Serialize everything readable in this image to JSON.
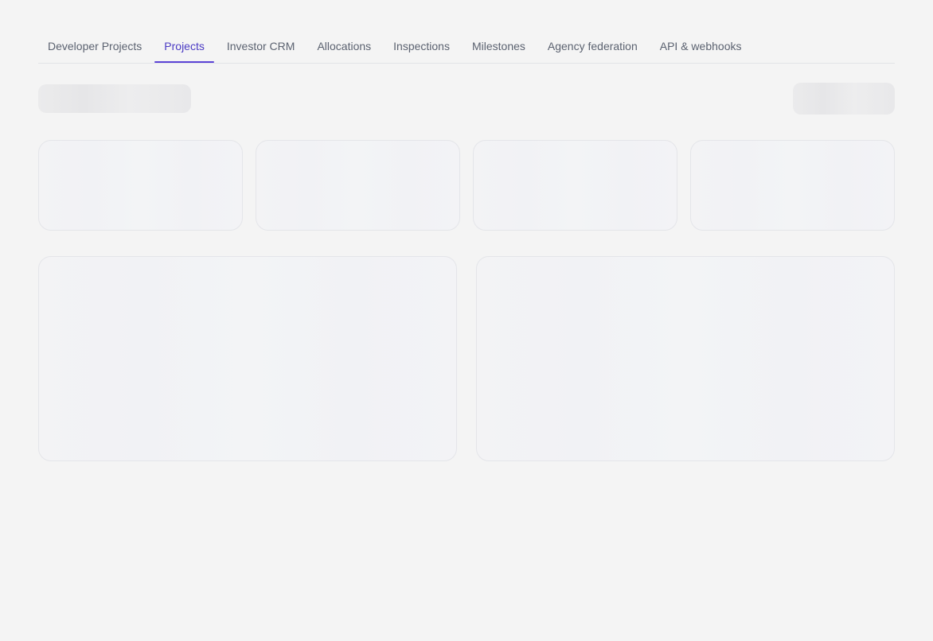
{
  "tabs": [
    {
      "label": "Developer Projects",
      "active": false
    },
    {
      "label": "Projects",
      "active": true
    },
    {
      "label": "Investor CRM",
      "active": false
    },
    {
      "label": "Allocations",
      "active": false
    },
    {
      "label": "Inspections",
      "active": false
    },
    {
      "label": "Milestones",
      "active": false
    },
    {
      "label": "Agency federation",
      "active": false
    },
    {
      "label": "API & webhooks",
      "active": false
    }
  ],
  "colors": {
    "background": "#f4f4f4",
    "tab_text": "#5b6270",
    "tab_active_text": "#4b3bc4",
    "tab_active_underline": "#5b43d6"
  }
}
